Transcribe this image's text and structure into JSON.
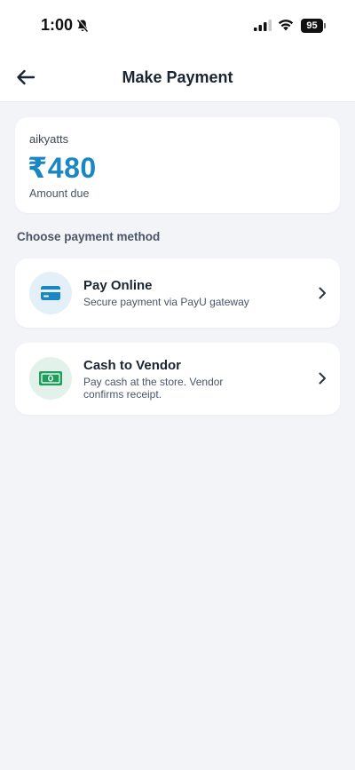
{
  "status_bar": {
    "time": "1:00",
    "battery": "95",
    "icons": [
      "bell-slash-icon",
      "cellular-signal-icon",
      "wifi-icon",
      "battery-icon"
    ]
  },
  "header": {
    "title": "Make Payment",
    "back_icon": "arrow-left-icon"
  },
  "amount_card": {
    "vendor": "aikyatts",
    "amount": "₹480",
    "label": "Amount due"
  },
  "section": {
    "title": "Choose payment method"
  },
  "methods": [
    {
      "title": "Pay Online",
      "description": "Secure payment via PayU gateway",
      "icon": "credit-card-icon"
    },
    {
      "title": "Cash to Vendor",
      "description": "Pay cash at the store. Vendor confirms receipt.",
      "icon": "cash-icon"
    }
  ],
  "colors": {
    "accent": "#1a86c2",
    "background": "#f2f4f8",
    "card": "#ffffff",
    "cash_green": "#1f9d5b"
  }
}
